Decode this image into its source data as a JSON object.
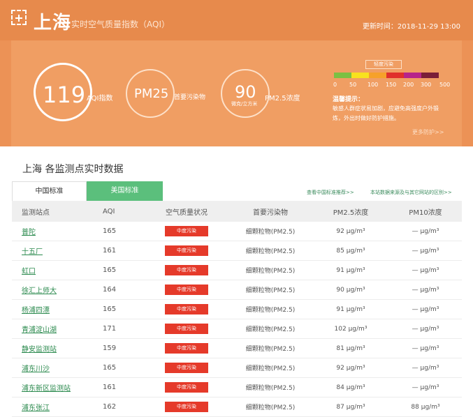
{
  "header": {
    "city": "上海",
    "subtitle": "实时空气质量指数（AQI）",
    "updated": "更新时间：2018-11-29 13:00"
  },
  "summary": {
    "aqi_value": "119",
    "aqi_label": "AQI指数",
    "pollutant_value": "PM25",
    "pollutant_label": "首要污染物",
    "conc_value": "90",
    "conc_unit": "微克/立方米",
    "conc_label": "PM2.5浓度"
  },
  "scale": {
    "current_level": "轻度污染",
    "ticks": [
      "0",
      "50",
      "100",
      "150",
      "200",
      "300",
      "500"
    ],
    "colors": [
      "#7bc043",
      "#f8e21e",
      "#f6a12a",
      "#e0302b",
      "#b6248a",
      "#7a1f38"
    ]
  },
  "advice": {
    "title": "温馨提示：",
    "text": "敏感人群症状易加剧，应避免高强度户外锻炼，外出时做好防护措施。",
    "more": "更多防护>>"
  },
  "stations_section": {
    "title": "上海 各监测点实时数据",
    "tab_china": "中国标准",
    "tab_us": "美国标准",
    "link_china_standard": "查看中国标准推荐>>",
    "link_data_source": "本站数据来源及与其它网站的区别>>"
  },
  "table": {
    "headers": [
      "监测站点",
      "AQI",
      "空气质量状况",
      "首要污染物",
      "PM2.5浓度",
      "PM10浓度"
    ],
    "rows": [
      {
        "station": "普陀",
        "aqi": "165",
        "status": "中度污染",
        "pollutant": "细颗粒物(PM2.5)",
        "pm25": "92 μg/m³",
        "pm10": "— μg/m³"
      },
      {
        "station": "十五厂",
        "aqi": "161",
        "status": "中度污染",
        "pollutant": "细颗粒物(PM2.5)",
        "pm25": "85 μg/m³",
        "pm10": "— μg/m³"
      },
      {
        "station": "虹口",
        "aqi": "165",
        "status": "中度污染",
        "pollutant": "细颗粒物(PM2.5)",
        "pm25": "91 μg/m³",
        "pm10": "— μg/m³"
      },
      {
        "station": "徐汇上师大",
        "aqi": "164",
        "status": "中度污染",
        "pollutant": "细颗粒物(PM2.5)",
        "pm25": "90 μg/m³",
        "pm10": "— μg/m³"
      },
      {
        "station": "杨浦四漂",
        "aqi": "165",
        "status": "中度污染",
        "pollutant": "细颗粒物(PM2.5)",
        "pm25": "91 μg/m³",
        "pm10": "— μg/m³"
      },
      {
        "station": "青浦淀山湖",
        "aqi": "171",
        "status": "中度污染",
        "pollutant": "细颗粒物(PM2.5)",
        "pm25": "102 μg/m³",
        "pm10": "— μg/m³"
      },
      {
        "station": "静安监测站",
        "aqi": "159",
        "status": "中度污染",
        "pollutant": "细颗粒物(PM2.5)",
        "pm25": "81 μg/m³",
        "pm10": "— μg/m³"
      },
      {
        "station": "浦东川沙",
        "aqi": "165",
        "status": "中度污染",
        "pollutant": "细颗粒物(PM2.5)",
        "pm25": "92 μg/m³",
        "pm10": "— μg/m³"
      },
      {
        "station": "浦东新区监测站",
        "aqi": "161",
        "status": "中度污染",
        "pollutant": "细颗粒物(PM2.5)",
        "pm25": "84 μg/m³",
        "pm10": "— μg/m³"
      },
      {
        "station": "浦东张江",
        "aqi": "162",
        "status": "中度污染",
        "pollutant": "细颗粒物(PM2.5)",
        "pm25": "87 μg/m³",
        "pm10": "88 μg/m³"
      }
    ]
  }
}
